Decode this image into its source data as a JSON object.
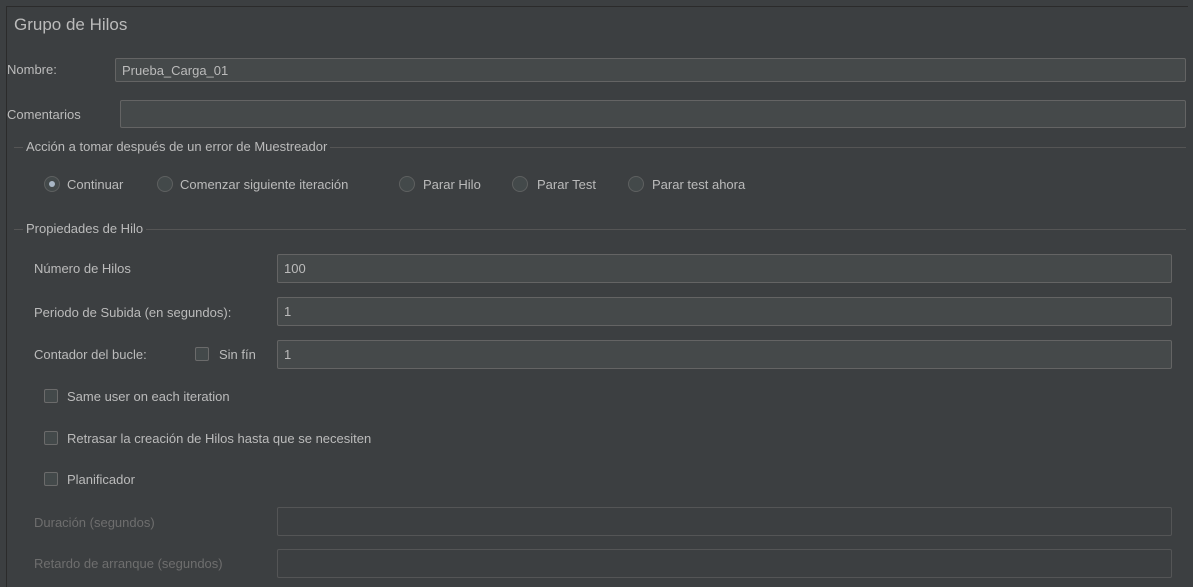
{
  "panel_title": "Grupo de Hilos",
  "name": {
    "label": "Nombre:",
    "value": "Prueba_Carga_01"
  },
  "comments": {
    "label": "Comentarios",
    "value": ""
  },
  "error_action": {
    "title": "Acción a tomar después de un error de Muestreador",
    "options": [
      {
        "label": "Continuar",
        "checked": true
      },
      {
        "label": "Comenzar siguiente iteración",
        "checked": false
      },
      {
        "label": "Parar Hilo",
        "checked": false
      },
      {
        "label": "Parar Test",
        "checked": false
      },
      {
        "label": "Parar test ahora",
        "checked": false
      }
    ]
  },
  "thread_props": {
    "title": "Propiedades de Hilo",
    "num_threads": {
      "label": "Número de Hilos",
      "value": "100"
    },
    "ramp_up": {
      "label": "Periodo de Subida (en segundos):",
      "value": "1"
    },
    "loop_count": {
      "label": "Contador del bucle:",
      "forever_label": "Sin fín",
      "forever_checked": false,
      "value": "1"
    },
    "same_user": {
      "label": "Same user on each iteration",
      "checked": false
    },
    "delay_creation": {
      "label": "Retrasar la creación de Hilos hasta que se necesiten",
      "checked": false
    },
    "scheduler": {
      "label": "Planificador",
      "checked": false
    },
    "duration": {
      "label": "Duración (segundos)",
      "value": ""
    },
    "startup_delay": {
      "label": "Retardo de arranque (segundos)",
      "value": ""
    }
  }
}
